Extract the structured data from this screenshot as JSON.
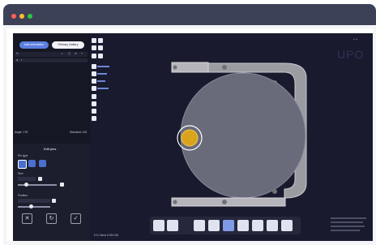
{
  "window": {
    "dot_colors": [
      "#fd5f57",
      "#febc2e",
      "#29c941"
    ]
  },
  "left_panel": {
    "buttons": [
      "Instrumentation",
      "Primary Gallery"
    ],
    "stats_left": "Angle: 178",
    "stats_right": "Standard: 100",
    "edit": {
      "title": "Edit pins",
      "type_label": "Pin type",
      "size_label": "Size",
      "size_value": "",
      "position_label": "Position",
      "position_value": ""
    }
  },
  "right_watermark": "UPO",
  "status_left": "0.0 / 0mm 0.00 0.00",
  "bottom_toolbar": {
    "icons": [
      "view-icon",
      "settings-icon",
      "fluid-icon",
      "wafer-icon",
      "stage-icon",
      "chip-icon",
      "sample-icon",
      "cube-icon",
      "pattern-icon"
    ],
    "active_index": 4
  }
}
